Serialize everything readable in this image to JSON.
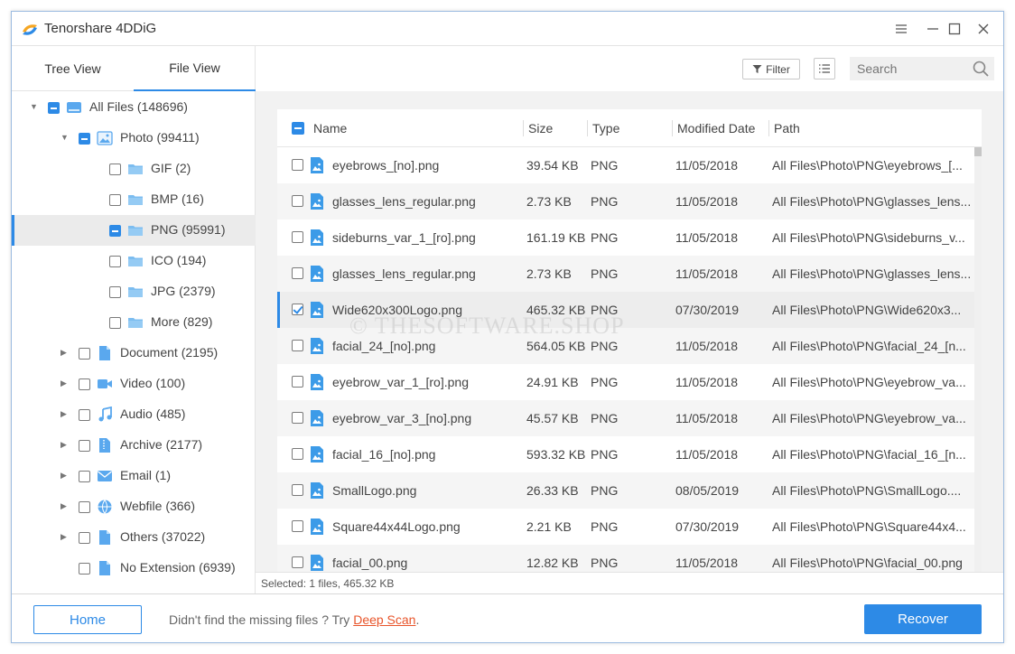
{
  "app": {
    "title": "Tenorshare 4DDiG"
  },
  "sidebar": {
    "tabs": [
      "Tree View",
      "File View"
    ],
    "tree": [
      {
        "label": "All Files (148696)",
        "icon": "drive-icon",
        "level": 0,
        "expand": "expanded",
        "check": "partial"
      },
      {
        "label": "Photo (99411)",
        "icon": "photo-icon",
        "level": 1,
        "expand": "expanded",
        "check": "partial"
      },
      {
        "label": "GIF (2)",
        "icon": "folder-icon",
        "level": 2,
        "expand": "none",
        "check": "none"
      },
      {
        "label": "BMP (16)",
        "icon": "folder-icon",
        "level": 2,
        "expand": "none",
        "check": "none"
      },
      {
        "label": "PNG (95991)",
        "icon": "folder-icon",
        "level": 2,
        "expand": "none",
        "check": "partial",
        "selected": true
      },
      {
        "label": "ICO (194)",
        "icon": "folder-icon",
        "level": 2,
        "expand": "none",
        "check": "none"
      },
      {
        "label": "JPG (2379)",
        "icon": "folder-icon",
        "level": 2,
        "expand": "none",
        "check": "none"
      },
      {
        "label": "More (829)",
        "icon": "folder-icon",
        "level": 2,
        "expand": "none",
        "check": "none"
      },
      {
        "label": "Document (2195)",
        "icon": "document-icon",
        "level": 1,
        "expand": "collapsed",
        "check": "none"
      },
      {
        "label": "Video (100)",
        "icon": "video-icon",
        "level": 1,
        "expand": "collapsed",
        "check": "none"
      },
      {
        "label": "Audio (485)",
        "icon": "audio-icon",
        "level": 1,
        "expand": "collapsed",
        "check": "none"
      },
      {
        "label": "Archive (2177)",
        "icon": "archive-icon",
        "level": 1,
        "expand": "collapsed",
        "check": "none"
      },
      {
        "label": "Email (1)",
        "icon": "email-icon",
        "level": 1,
        "expand": "collapsed",
        "check": "none"
      },
      {
        "label": "Webfile (366)",
        "icon": "globe-icon",
        "level": 1,
        "expand": "collapsed",
        "check": "none"
      },
      {
        "label": "Others (37022)",
        "icon": "file-icon",
        "level": 1,
        "expand": "collapsed",
        "check": "none"
      },
      {
        "label": "No Extension (6939)",
        "icon": "file-icon",
        "level": 1,
        "expand": "none",
        "check": "none"
      }
    ]
  },
  "toolbar": {
    "filter_label": "Filter",
    "search_placeholder": "Search"
  },
  "table": {
    "columns": [
      "Name",
      "Size",
      "Type",
      "Modified Date",
      "Path"
    ],
    "rows": [
      {
        "name": "eyebrows_[no].png",
        "size": "39.54 KB",
        "type": "PNG",
        "date": "11/05/2018",
        "path": "All Files\\Photo\\PNG\\eyebrows_[...",
        "checked": false
      },
      {
        "name": "glasses_lens_regular.png",
        "size": "2.73 KB",
        "type": "PNG",
        "date": "11/05/2018",
        "path": "All Files\\Photo\\PNG\\glasses_lens...",
        "checked": false
      },
      {
        "name": "sideburns_var_1_[ro].png",
        "size": "161.19 KB",
        "type": "PNG",
        "date": "11/05/2018",
        "path": "All Files\\Photo\\PNG\\sideburns_v...",
        "checked": false
      },
      {
        "name": "glasses_lens_regular.png",
        "size": "2.73 KB",
        "type": "PNG",
        "date": "11/05/2018",
        "path": "All Files\\Photo\\PNG\\glasses_lens...",
        "checked": false
      },
      {
        "name": "Wide620x300Logo.png",
        "size": "465.32 KB",
        "type": "PNG",
        "date": "07/30/2019",
        "path": "All Files\\Photo\\PNG\\Wide620x3...",
        "checked": true
      },
      {
        "name": "facial_24_[no].png",
        "size": "564.05 KB",
        "type": "PNG",
        "date": "11/05/2018",
        "path": "All Files\\Photo\\PNG\\facial_24_[n...",
        "checked": false
      },
      {
        "name": "eyebrow_var_1_[ro].png",
        "size": "24.91 KB",
        "type": "PNG",
        "date": "11/05/2018",
        "path": "All Files\\Photo\\PNG\\eyebrow_va...",
        "checked": false
      },
      {
        "name": "eyebrow_var_3_[no].png",
        "size": "45.57 KB",
        "type": "PNG",
        "date": "11/05/2018",
        "path": "All Files\\Photo\\PNG\\eyebrow_va...",
        "checked": false
      },
      {
        "name": "facial_16_[no].png",
        "size": "593.32 KB",
        "type": "PNG",
        "date": "11/05/2018",
        "path": "All Files\\Photo\\PNG\\facial_16_[n...",
        "checked": false
      },
      {
        "name": "SmallLogo.png",
        "size": "26.33 KB",
        "type": "PNG",
        "date": "08/05/2019",
        "path": "All Files\\Photo\\PNG\\SmallLogo....",
        "checked": false
      },
      {
        "name": "Square44x44Logo.png",
        "size": "2.21 KB",
        "type": "PNG",
        "date": "07/30/2019",
        "path": "All Files\\Photo\\PNG\\Square44x4...",
        "checked": false
      },
      {
        "name": "facial_00.png",
        "size": "12.82 KB",
        "type": "PNG",
        "date": "11/05/2018",
        "path": "All Files\\Photo\\PNG\\facial_00.png",
        "checked": false
      }
    ]
  },
  "watermark": "© THESOFTWARE.SHOP",
  "status": {
    "selected_text": "Selected: 1 files, 465.32 KB"
  },
  "footer": {
    "home_label": "Home",
    "hint_text": "Didn't find the missing files ? Try ",
    "deep_scan_label": "Deep Scan",
    "hint_suffix": ".",
    "recover_label": "Recover"
  },
  "colors": {
    "accent": "#2d8ae6",
    "link": "#e8542a",
    "folder": "#7cbdf0"
  }
}
